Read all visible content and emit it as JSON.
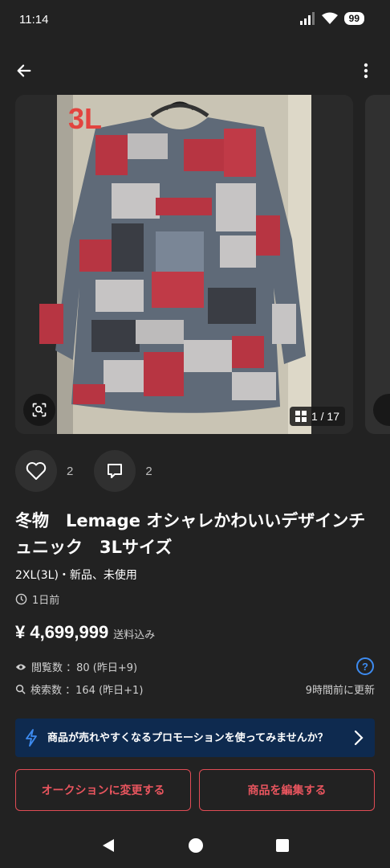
{
  "status": {
    "time": "11:14",
    "battery": "99"
  },
  "carousel": {
    "counter": "1 / 17",
    "size_label": "3L"
  },
  "social": {
    "likes": "2",
    "comments": "2"
  },
  "item": {
    "title": "冬物　Lemage オシャレかわいいデザインチュニック　3Lサイズ",
    "condition": "2XL(3L)・新品、未使用",
    "posted": "1日前",
    "price": "¥ 4,699,999",
    "price_note": "送料込み",
    "views": "閲覧数 ：80 (昨日+9)",
    "searches": "検索数 ：164 (昨日+1)",
    "updated": "9時間前に更新"
  },
  "promo": {
    "text": "商品が売れやすくなるプロモーションを使ってみませんか？"
  },
  "buttons": {
    "auction": "オークションに変更する",
    "edit": "商品を編集する"
  },
  "help_label": "?",
  "colors": {
    "accent": "#e04c55",
    "promo_bg": "#0e2a4f",
    "link": "#3d8bf0"
  }
}
